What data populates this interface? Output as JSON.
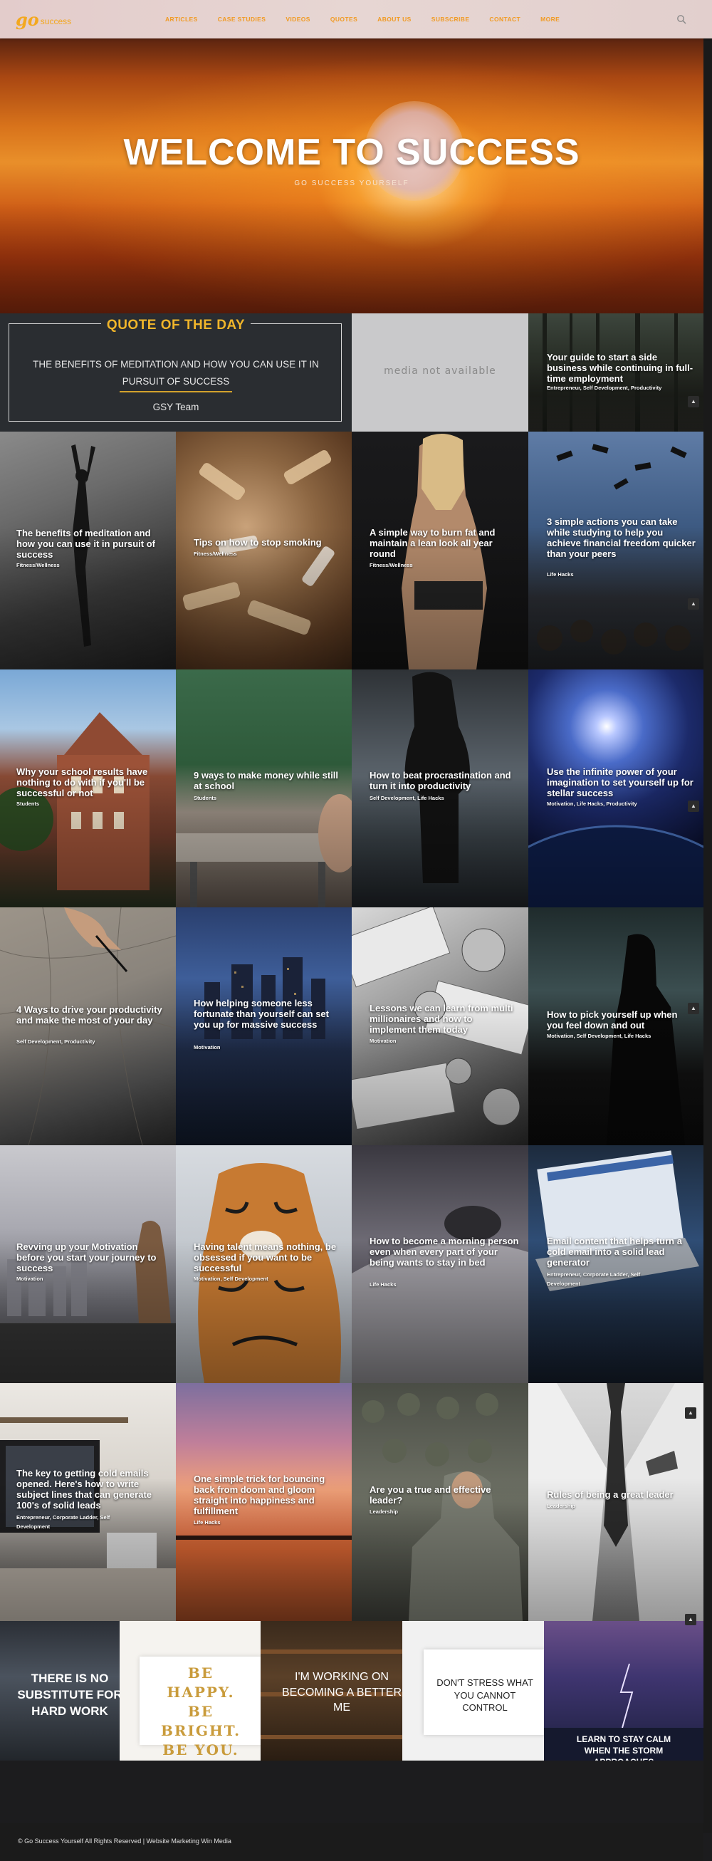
{
  "nav": {
    "logo_mark": "go",
    "logo_text": "success",
    "items": [
      "ARTICLES",
      "CASE STUDIES",
      "VIDEOS",
      "QUOTES",
      "ABOUT US",
      "SUBSCRIBE",
      "CONTACT",
      "MORE"
    ]
  },
  "hero": {
    "title": "WELCOME TO SUCCESS",
    "subtitle": "GO SUCCESS YOURSELF"
  },
  "quote": {
    "heading": "QUOTE OF THE DAY",
    "text": "THE BENEFITS OF MEDITATION AND HOW YOU CAN USE IT IN PURSUIT OF SUCCESS",
    "author": "GSY Team"
  },
  "media_placeholder": "media not available",
  "articles": [
    {
      "title": "Your guide to start a side business while continuing in full-time employment",
      "category": "Entrepreneur, Self Development, Productivity"
    },
    {
      "title": "The benefits of meditation and how you can use it in pursuit of success",
      "category": "Fitness/Wellness"
    },
    {
      "title": "Tips on how to stop smoking",
      "category": "Fitness/Wellness"
    },
    {
      "title": "A simple way to burn fat and maintain a lean look all year round",
      "category": "Fitness/Wellness"
    },
    {
      "title": "3 simple actions you can take while studying to help you achieve financial freedom quicker than your peers",
      "category": "Life Hacks"
    },
    {
      "title": "Why your school results have nothing to do with if you'll be successful or not",
      "category": "Students"
    },
    {
      "title": "9 ways to make money while still at school",
      "category": "Students"
    },
    {
      "title": "How to beat procrastination and turn it into productivity",
      "category": "Self Development, Life Hacks"
    },
    {
      "title": "Use the infinite power of your imagination to set yourself up for stellar success",
      "category": "Motivation, Life Hacks, Productivity"
    },
    {
      "title": "4 Ways to drive your productivity and make the most of your day",
      "category": "Self Development, Productivity"
    },
    {
      "title": "How helping someone less fortunate than yourself can set you up for massive success",
      "category": "Motivation"
    },
    {
      "title": "Lessons we can learn from multi millionaires and how to implement them today",
      "category": "Motivation"
    },
    {
      "title": "How to pick yourself up when you feel down and out",
      "category": "Motivation, Self Development, Life Hacks"
    },
    {
      "title": "Revving up your Motivation before you start your journey to success",
      "category": "Motivation"
    },
    {
      "title": "Having talent means nothing, be obsessed if you want to be successful",
      "category": "Motivation, Self Development"
    },
    {
      "title": "How to become a morning person even when every part of your being wants to stay in bed",
      "category": "Life Hacks"
    },
    {
      "title": "Email content that helps turn a cold email into a solid lead generator",
      "category": "Entrepreneur, Corporate Ladder, Self Development"
    },
    {
      "title": "The key to getting cold emails opened. Here's how to write subject lines that can generate 100's of solid leads",
      "category": "Entrepreneur, Corporate Ladder, Self Development"
    },
    {
      "title": "One simple trick for bouncing back from doom and gloom straight into happiness and fulfillment",
      "category": "Life Hacks"
    },
    {
      "title": "Are you a true and effective leader?",
      "category": "Leadership"
    },
    {
      "title": "Rules of being a great leader",
      "category": "Leadership"
    }
  ],
  "posters": [
    {
      "text": "THERE IS NO SUBSTITUTE FOR HARD WORK"
    },
    {
      "text": "BE HAPPY. BE BRIGHT. BE YOU."
    },
    {
      "text": "I'M WORKING ON BECOMING A BETTER ME"
    },
    {
      "text": "DON'T STRESS WHAT YOU CANNOT CONTROL"
    },
    {
      "text": "LEARN TO STAY CALM WHEN THE STORM APPROACHES"
    }
  ],
  "footer": {
    "text": "© Go Success Yourself All Rights Reserved  |  Website Marketing Win Media"
  },
  "colors": {
    "accent": "#f19a22",
    "quote_gold": "#f0b52a",
    "dark_bg": "#1c1c1e"
  }
}
